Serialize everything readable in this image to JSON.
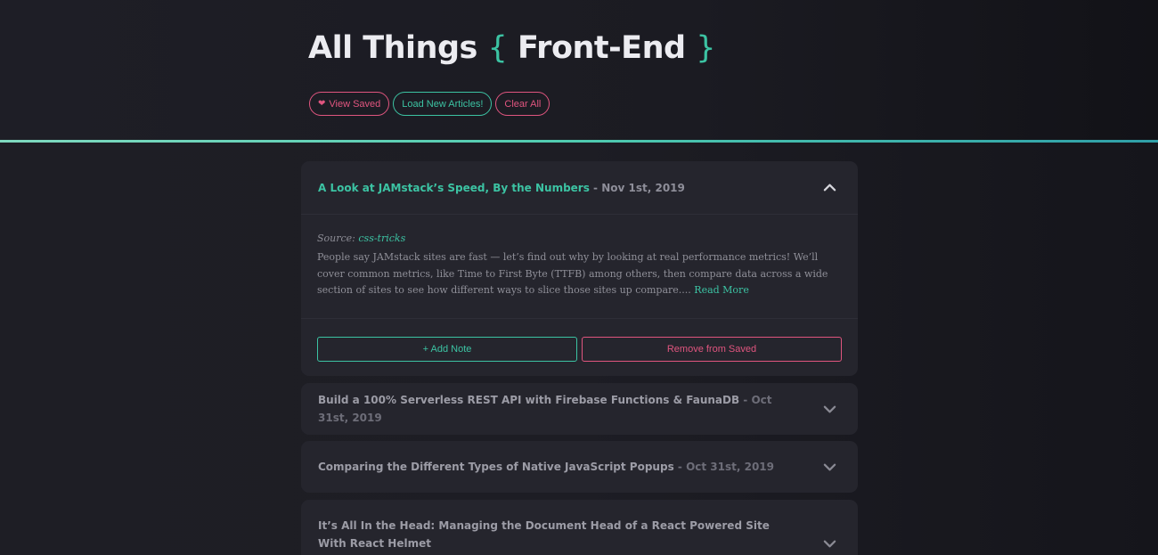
{
  "header": {
    "title_prefix": "All Things",
    "brace_open": "{",
    "title_core": "Front-End",
    "brace_close": "}",
    "buttons": {
      "view_saved": "View Saved",
      "load_new": "Load New Articles!",
      "clear_all": "Clear All"
    }
  },
  "colors": {
    "accent": "#3cc3a3",
    "danger": "#e0557f",
    "background": "#1b1b22",
    "card": "#25252d"
  },
  "articles": [
    {
      "title": "A Look at JAMstack’s Speed, By the Numbers",
      "separator": " - ",
      "date": "Nov 1st, 2019",
      "expanded": true,
      "source_label": "Source:",
      "source_name": "css-tricks",
      "summary": "People say JAMstack sites are fast — let’s find out why by looking at real performance metrics! We’ll cover common metrics, like Time to First Byte (TTFB) among others, then compare data across a wide section of sites to see how different ways to slice those sites up compare....",
      "read_more": "Read More",
      "add_note": "+ Add Note",
      "remove_saved": "Remove from Saved"
    },
    {
      "title": "Build a 100% Serverless REST API with Firebase Functions & FaunaDB",
      "separator": " - ",
      "date": "Oct 31st, 2019",
      "expanded": false
    },
    {
      "title": "Comparing the Different Types of Native JavaScript Popups",
      "separator": " - ",
      "date": "Oct 31st, 2019",
      "expanded": false
    },
    {
      "title": "It’s All In the Head: Managing the Document Head of a React Powered Site With React Helmet",
      "separator": "",
      "date": "",
      "expanded": false
    }
  ],
  "icons": {
    "heart": "heart-icon",
    "chevron_up": "chevron-up-icon",
    "chevron_down": "chevron-down-icon"
  }
}
